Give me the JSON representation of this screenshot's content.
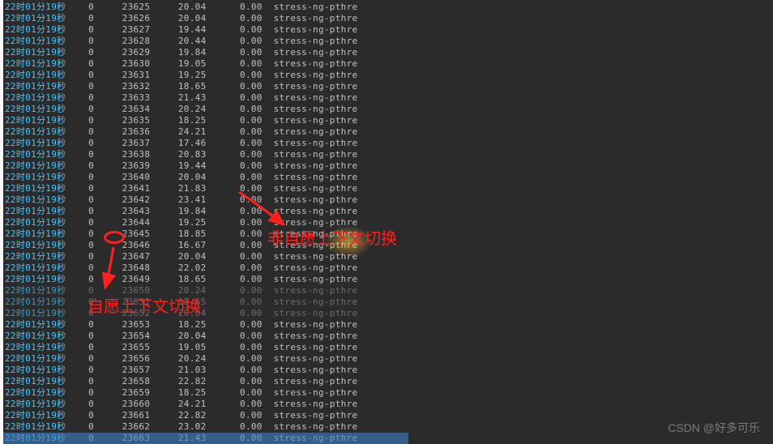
{
  "rows": [
    {
      "ts": "22时01分19秒",
      "c1": "0",
      "pid": "23625",
      "v1": "20.04",
      "v2": "0.00",
      "cmd": "stress-ng-pthre"
    },
    {
      "ts": "22时01分19秒",
      "c1": "0",
      "pid": "23626",
      "v1": "20.04",
      "v2": "0.00",
      "cmd": "stress-ng-pthre"
    },
    {
      "ts": "22时01分19秒",
      "c1": "0",
      "pid": "23627",
      "v1": "19.44",
      "v2": "0.00",
      "cmd": "stress-ng-pthre"
    },
    {
      "ts": "22时01分19秒",
      "c1": "0",
      "pid": "23628",
      "v1": "20.44",
      "v2": "0.00",
      "cmd": "stress-ng-pthre"
    },
    {
      "ts": "22时01分19秒",
      "c1": "0",
      "pid": "23629",
      "v1": "19.84",
      "v2": "0.00",
      "cmd": "stress-ng-pthre"
    },
    {
      "ts": "22时01分19秒",
      "c1": "0",
      "pid": "23630",
      "v1": "19.05",
      "v2": "0.00",
      "cmd": "stress-ng-pthre"
    },
    {
      "ts": "22时01分19秒",
      "c1": "0",
      "pid": "23631",
      "v1": "19.25",
      "v2": "0.00",
      "cmd": "stress-ng-pthre"
    },
    {
      "ts": "22时01分19秒",
      "c1": "0",
      "pid": "23632",
      "v1": "18.65",
      "v2": "0.00",
      "cmd": "stress-ng-pthre"
    },
    {
      "ts": "22时01分19秒",
      "c1": "0",
      "pid": "23633",
      "v1": "21.43",
      "v2": "0.00",
      "cmd": "stress-ng-pthre"
    },
    {
      "ts": "22时01分19秒",
      "c1": "0",
      "pid": "23634",
      "v1": "20.24",
      "v2": "0.00",
      "cmd": "stress-ng-pthre"
    },
    {
      "ts": "22时01分19秒",
      "c1": "0",
      "pid": "23635",
      "v1": "18.25",
      "v2": "0.00",
      "cmd": "stress-ng-pthre"
    },
    {
      "ts": "22时01分19秒",
      "c1": "0",
      "pid": "23636",
      "v1": "24.21",
      "v2": "0.00",
      "cmd": "stress-ng-pthre"
    },
    {
      "ts": "22时01分19秒",
      "c1": "0",
      "pid": "23637",
      "v1": "17.46",
      "v2": "0.00",
      "cmd": "stress-ng-pthre"
    },
    {
      "ts": "22时01分19秒",
      "c1": "0",
      "pid": "23638",
      "v1": "20.83",
      "v2": "0.00",
      "cmd": "stress-ng-pthre"
    },
    {
      "ts": "22时01分19秒",
      "c1": "0",
      "pid": "23639",
      "v1": "19.44",
      "v2": "0.00",
      "cmd": "stress-ng-pthre"
    },
    {
      "ts": "22时01分19秒",
      "c1": "0",
      "pid": "23640",
      "v1": "20.04",
      "v2": "0.00",
      "cmd": "stress-ng-pthre"
    },
    {
      "ts": "22时01分19秒",
      "c1": "0",
      "pid": "23641",
      "v1": "21.83",
      "v2": "0.00",
      "cmd": "stress-ng-pthre"
    },
    {
      "ts": "22时01分19秒",
      "c1": "0",
      "pid": "23642",
      "v1": "23.41",
      "v2": "0.00",
      "cmd": "stress-ng-pthre"
    },
    {
      "ts": "22时01分19秒",
      "c1": "0",
      "pid": "23643",
      "v1": "19.84",
      "v2": "0.00",
      "cmd": "stress-ng-pthre"
    },
    {
      "ts": "22时01分19秒",
      "c1": "0",
      "pid": "23644",
      "v1": "19.25",
      "v2": "0.00",
      "cmd": "stress-ng-pthre"
    },
    {
      "ts": "22时01分19秒",
      "c1": "0",
      "pid": "23645",
      "v1": "18.85",
      "v2": "0.00",
      "cmd": "stress-ng-pthre"
    },
    {
      "ts": "22时01分19秒",
      "c1": "0",
      "pid": "23646",
      "v1": "16.67",
      "v2": "0.00",
      "cmd": "stress-ng-pthre"
    },
    {
      "ts": "22时01分19秒",
      "c1": "0",
      "pid": "23647",
      "v1": "20.04",
      "v2": "0.00",
      "cmd": "stress-ng-pthre"
    },
    {
      "ts": "22时01分19秒",
      "c1": "0",
      "pid": "23648",
      "v1": "22.02",
      "v2": "0.00",
      "cmd": "stress-ng-pthre"
    },
    {
      "ts": "22时01分19秒",
      "c1": "0",
      "pid": "23649",
      "v1": "18.65",
      "v2": "0.00",
      "cmd": "stress-ng-pthre"
    },
    {
      "ts": "22时01分19秒",
      "c1": "0",
      "pid": "23650",
      "v1": "20.24",
      "v2": "0.00",
      "cmd": "stress-ng-pthre"
    },
    {
      "ts": "22时01分19秒",
      "c1": "0",
      "pid": "23651",
      "v1": "18.65",
      "v2": "0.00",
      "cmd": "stress-ng-pthre"
    },
    {
      "ts": "22时01分19秒",
      "c1": "0",
      "pid": "23652",
      "v1": "20.04",
      "v2": "0.00",
      "cmd": "stress-ng-pthre"
    },
    {
      "ts": "22时01分19秒",
      "c1": "0",
      "pid": "23653",
      "v1": "18.25",
      "v2": "0.00",
      "cmd": "stress-ng-pthre"
    },
    {
      "ts": "22时01分19秒",
      "c1": "0",
      "pid": "23654",
      "v1": "20.04",
      "v2": "0.00",
      "cmd": "stress-ng-pthre"
    },
    {
      "ts": "22时01分19秒",
      "c1": "0",
      "pid": "23655",
      "v1": "19.05",
      "v2": "0.00",
      "cmd": "stress-ng-pthre"
    },
    {
      "ts": "22时01分19秒",
      "c1": "0",
      "pid": "23656",
      "v1": "20.24",
      "v2": "0.00",
      "cmd": "stress-ng-pthre"
    },
    {
      "ts": "22时01分19秒",
      "c1": "0",
      "pid": "23657",
      "v1": "21.03",
      "v2": "0.00",
      "cmd": "stress-ng-pthre"
    },
    {
      "ts": "22时01分19秒",
      "c1": "0",
      "pid": "23658",
      "v1": "22.82",
      "v2": "0.00",
      "cmd": "stress-ng-pthre"
    },
    {
      "ts": "22时01分19秒",
      "c1": "0",
      "pid": "23659",
      "v1": "18.25",
      "v2": "0.00",
      "cmd": "stress-ng-pthre"
    },
    {
      "ts": "22时01分19秒",
      "c1": "0",
      "pid": "23660",
      "v1": "24.21",
      "v2": "0.00",
      "cmd": "stress-ng-pthre"
    },
    {
      "ts": "22时01分19秒",
      "c1": "0",
      "pid": "23661",
      "v1": "22.82",
      "v2": "0.00",
      "cmd": "stress-ng-pthre"
    },
    {
      "ts": "22时01分19秒",
      "c1": "0",
      "pid": "23662",
      "v1": "23.02",
      "v2": "0.00",
      "cmd": "stress-ng-pthre"
    },
    {
      "ts": "22时01分19秒",
      "c1": "0",
      "pid": "23663",
      "v1": "21.43",
      "v2": "0.00",
      "cmd": "stress-ng-pthre"
    }
  ],
  "annotation": {
    "label1": "非自愿上下文切换",
    "label2": "自愿上下文切换"
  },
  "watermark": "CSDN @好多可乐"
}
